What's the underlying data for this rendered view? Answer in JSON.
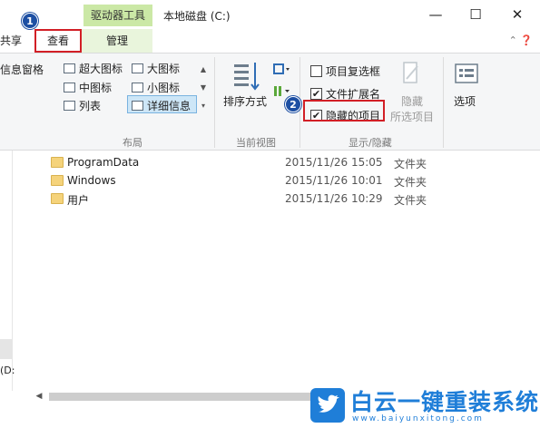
{
  "titlebar": {
    "context_tab": "驱动器工具",
    "title": "本地磁盘 (C:)",
    "minimize": "—",
    "maximize": "☐",
    "close": "✕"
  },
  "tabs": {
    "share": "共享",
    "view": "查看",
    "manage": "管理",
    "ribbon_controls": "⌃ ❓"
  },
  "ribbon": {
    "nav_pane": "信息窗格",
    "layout": {
      "items": [
        "超大图标",
        "大图标",
        "中图标",
        "小图标",
        "列表",
        "详细信息"
      ],
      "group_label": "布局"
    },
    "current_view": {
      "sort_label": "排序方式",
      "group_label": "当前视图"
    },
    "show_hide": {
      "item_checkboxes": "项目复选框",
      "file_extensions": "文件扩展名",
      "hidden_items": "隐藏的项目",
      "hide_selected_1": "隐藏",
      "hide_selected_2": "所选项目",
      "group_label": "显示/隐藏",
      "item_checkboxes_checked": false,
      "file_extensions_checked": true,
      "hidden_items_checked": true
    },
    "options": "选项"
  },
  "badges": {
    "one": "1",
    "two": "2"
  },
  "files": [
    {
      "name": "ProgramData",
      "date": "2015/11/26 15:05",
      "type": "文件夹"
    },
    {
      "name": "Windows",
      "date": "2015/11/26 10:01",
      "type": "文件夹"
    },
    {
      "name": "用户",
      "date": "2015/11/26 10:29",
      "type": "文件夹"
    }
  ],
  "sidebar": {
    "drive": "(D:"
  },
  "watermark": {
    "title": "白云一键重装系统",
    "url": "www.baiyunxitong.com"
  },
  "colors": {
    "highlight": "#d21f26",
    "badge": "#1d4fa3",
    "brand": "#1f7ed8"
  }
}
